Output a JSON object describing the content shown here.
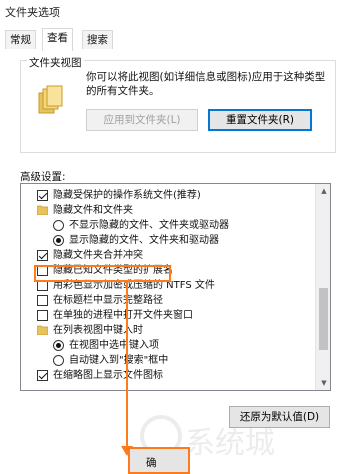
{
  "window": {
    "title": "文件夹选项"
  },
  "tabs": [
    {
      "label": "常规",
      "active": false
    },
    {
      "label": "查看",
      "active": true
    },
    {
      "label": "搜索",
      "active": false
    }
  ],
  "folder_view": {
    "legend": "文件夹视图",
    "description": "你可以将此视图(如详细信息或图标)应用于这种类型的所有文件夹。",
    "apply_button": "应用到文件夹(L)",
    "reset_button": "重置文件夹(R)"
  },
  "advanced": {
    "label": "高级设置:",
    "items": [
      {
        "kind": "checkbox",
        "checked": true,
        "indent": 0,
        "label": "隐藏受保护的操作系统文件(推荐)"
      },
      {
        "kind": "folder",
        "indent": 0,
        "label": "隐藏文件和文件夹"
      },
      {
        "kind": "radio",
        "checked": false,
        "indent": 1,
        "label": "不显示隐藏的文件、文件夹或驱动器"
      },
      {
        "kind": "radio",
        "checked": true,
        "indent": 1,
        "label": "显示隐藏的文件、文件夹和驱动器"
      },
      {
        "kind": "checkbox",
        "checked": true,
        "indent": 0,
        "label": "隐藏文件夹合并冲突"
      },
      {
        "kind": "checkbox",
        "checked": false,
        "indent": 0,
        "label": "隐藏已知文件类型的扩展名"
      },
      {
        "kind": "checkbox",
        "checked": false,
        "indent": 0,
        "label": "用彩色显示加密或压缩的 NTFS 文件"
      },
      {
        "kind": "checkbox",
        "checked": false,
        "indent": 0,
        "label": "在标题栏中显示完整路径"
      },
      {
        "kind": "checkbox",
        "checked": false,
        "indent": 0,
        "label": "在单独的进程中打开文件夹窗口"
      },
      {
        "kind": "folder",
        "indent": 0,
        "label": "在列表视图中键入时"
      },
      {
        "kind": "radio",
        "checked": true,
        "indent": 1,
        "label": "在视图中选中键入项"
      },
      {
        "kind": "radio",
        "checked": false,
        "indent": 1,
        "label": "自动键入到\"搜索\"框中"
      },
      {
        "kind": "checkbox",
        "checked": true,
        "indent": 0,
        "label": "在缩略图上显示文件图标"
      }
    ],
    "restore_button": "还原为默认值(D)"
  },
  "ok_button": "确",
  "watermark": "系统城"
}
